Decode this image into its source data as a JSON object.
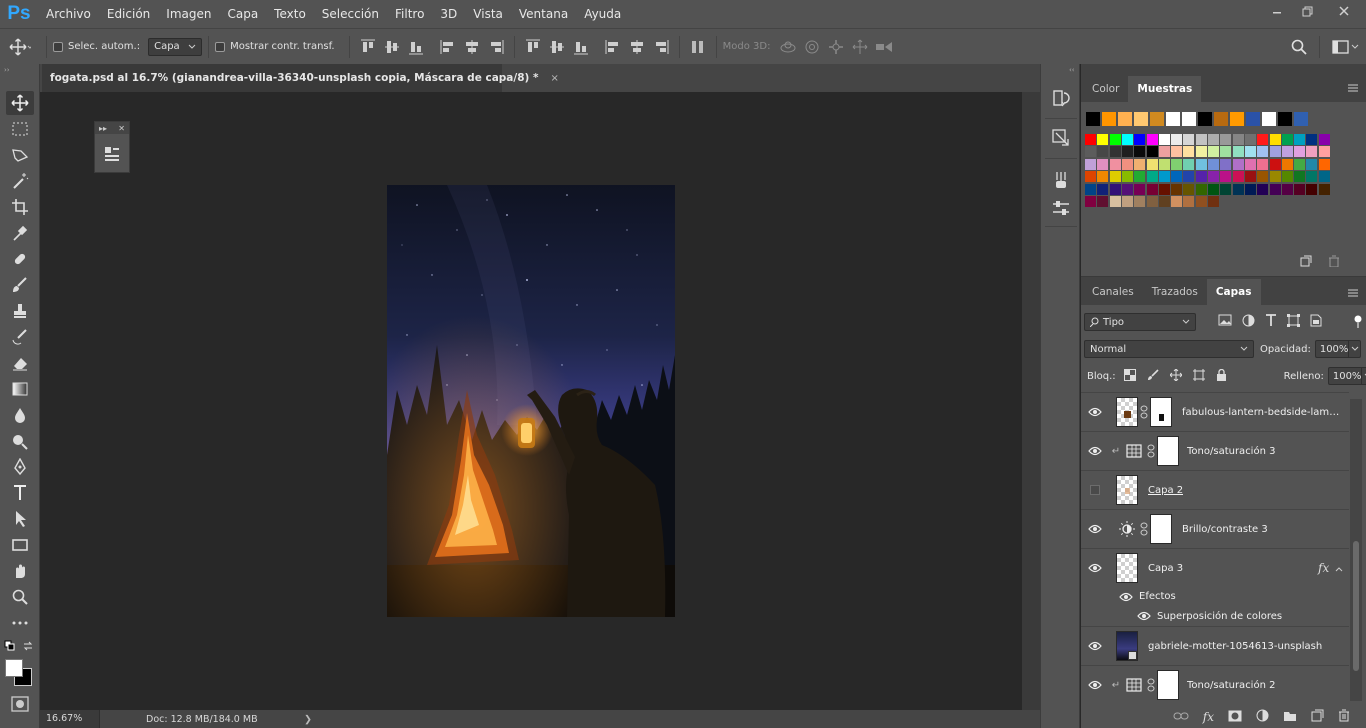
{
  "app": {
    "logo": "Ps"
  },
  "menu": [
    "Archivo",
    "Edición",
    "Imagen",
    "Capa",
    "Texto",
    "Selección",
    "Filtro",
    "3D",
    "Vista",
    "Ventana",
    "Ayuda"
  ],
  "options": {
    "auto_select_label": "Selec. autom.:",
    "auto_select_value": "Capa",
    "show_transform_label": "Mostrar contr. transf.",
    "mode3d_label": "Modo 3D:"
  },
  "document": {
    "tab_title": "fogata.psd al 16.7% (gianandrea-villa-36340-unsplash copia, Máscara de capa/8) *",
    "close_glyph": "×"
  },
  "status": {
    "zoom": "16.67%",
    "doc_info": "Doc: 12.8 MB/184.0 MB",
    "arrow": "❯"
  },
  "swatch_panel": {
    "tabs": [
      {
        "label": "Color",
        "active": false
      },
      {
        "label": "Muestras",
        "active": true
      }
    ],
    "top_row": [
      "#000000",
      "#ff9500",
      "#ffb050",
      "#ffc870",
      "#d08a20",
      "#ffffff",
      "#ffffff",
      "#000000",
      "#b86a10",
      "#ff9a00",
      "#2a52a8",
      "#ffffff",
      "#000000",
      "#3060b0"
    ],
    "grid": [
      [
        "#ff0000",
        "#ffff00",
        "#00ff00",
        "#00ffff",
        "#0000ff",
        "#ff00ff",
        "#ffffff",
        "#ebebeb",
        "#d6d6d6",
        "#c2c2c2",
        "#adadad",
        "#999999",
        "#858585",
        "#707070",
        "#ff1a1a",
        "#ffdd00",
        "#00a050",
        "#00a0c0",
        "#003080",
        "#8800aa"
      ],
      [
        "#5c5c5c",
        "#474747",
        "#333333",
        "#1f1f1f",
        "#0a0a0a",
        "#000000",
        "#eea0a0",
        "#ffc0a0",
        "#ffe0a0",
        "#f0f0a0",
        "#d0f0a0",
        "#a0e0a0",
        "#90e0c0",
        "#a0e0f0",
        "#a0c0f0",
        "#a0a0e0",
        "#c0a0e0",
        "#e0a0e0",
        "#f0a0c0",
        "#ffa0a0"
      ],
      [
        "#c0a0d8",
        "#e090c0",
        "#f090a0",
        "#f09080",
        "#f0b070",
        "#f0e070",
        "#c0e070",
        "#80d070",
        "#70d0b0",
        "#70c0e0",
        "#7090d8",
        "#8070c8",
        "#b070c8",
        "#e070b0",
        "#f07090",
        "#cc1010",
        "#ee7700",
        "#44aa44",
        "#2288aa",
        "#ff6600"
      ],
      [
        "#dd4400",
        "#ee8800",
        "#ddcc00",
        "#88bb00",
        "#22aa33",
        "#00aa88",
        "#0099cc",
        "#0066bb",
        "#2244aa",
        "#5522aa",
        "#8822aa",
        "#bb1188",
        "#cc1155",
        "#991111",
        "#995500",
        "#998800",
        "#558800",
        "#117722",
        "#007766",
        "#006688"
      ],
      [
        "#004488",
        "#112277",
        "#331177",
        "#551177",
        "#770055",
        "#770033",
        "#661100",
        "#663300",
        "#665500",
        "#336600",
        "#005511",
        "#004433",
        "#003355",
        "#001a55",
        "#220055",
        "#440055",
        "#550044",
        "#550022",
        "#440000",
        "#442200"
      ],
      [
        "#800040",
        "#601030",
        "#d8c0a0",
        "#c0a080",
        "#a08060",
        "#806040",
        "#604020",
        "#d09060",
        "#b07040",
        "#905020",
        "#703010"
      ]
    ]
  },
  "layers_panel": {
    "tabs": [
      {
        "label": "Canales",
        "active": false
      },
      {
        "label": "Trazados",
        "active": false
      },
      {
        "label": "Capas",
        "active": true
      }
    ],
    "filter_label": "Tipo",
    "blend_mode": "Normal",
    "opacity_label": "Opacidad:",
    "opacity_value": "100%",
    "lock_label": "Bloq.:",
    "fill_label": "Relleno:",
    "fill_value": "100%",
    "fx_label": "fx",
    "effects_label": "Efectos",
    "effect_item": "Superposición de colores",
    "layers": [
      {
        "name": "fabulous-lantern-bedside-lamp-...",
        "kind": "image-mask",
        "visible": true
      },
      {
        "name": "Tono/saturación 3",
        "kind": "hue-sat",
        "visible": true
      },
      {
        "name": "Capa 2",
        "kind": "empty",
        "visible": false
      },
      {
        "name": "Brillo/contraste 3",
        "kind": "brightness",
        "visible": true
      },
      {
        "name": "Capa 3",
        "kind": "layer-fx",
        "visible": true
      },
      {
        "name": "gabriele-motter-1054613-unsplash",
        "kind": "photo",
        "visible": true
      },
      {
        "name": "Tono/saturación 2",
        "kind": "hue-sat",
        "visible": true
      }
    ]
  },
  "colors": {
    "accent_ps": "#31a8ff",
    "ui_bg": "#535353",
    "canvas_bg": "#282828"
  }
}
